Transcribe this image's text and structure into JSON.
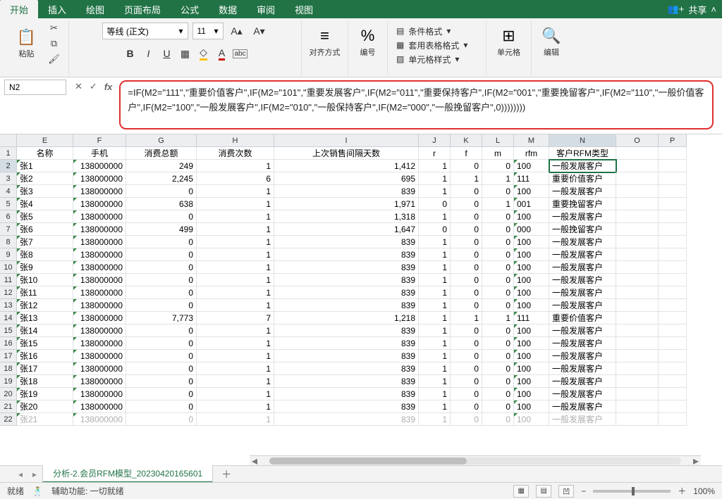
{
  "tabs": {
    "items": [
      "开始",
      "插入",
      "绘图",
      "页面布局",
      "公式",
      "数据",
      "审阅",
      "视图"
    ],
    "active_index": 0,
    "share": "共享"
  },
  "ribbon": {
    "clipboard": {
      "paste": "粘贴",
      "group": ""
    },
    "font": {
      "name": "等线 (正文)",
      "size": "11",
      "buttons": {
        "bold": "B",
        "italic": "I",
        "underline": "U"
      }
    },
    "alignment": {
      "label": "对齐方式",
      "wrap": "ab"
    },
    "number": {
      "label": "编号",
      "percent": "%"
    },
    "style": {
      "cond": "条件格式",
      "table": "套用表格格式",
      "cell": "单元格样式"
    },
    "cells": {
      "label": "单元格"
    },
    "editing": {
      "label": "编辑"
    }
  },
  "formula_bar": {
    "cell_ref": "N2",
    "formula": "=IF(M2=\"111\",\"重要价值客户\",IF(M2=\"101\",\"重要发展客户\",IF(M2=\"011\",\"重要保持客户\",IF(M2=\"001\",\"重要挽留客户\",IF(M2=\"110\",\"一般价值客户\",IF(M2=\"100\",\"一般发展客户\",IF(M2=\"010\",\"一般保持客户\",IF(M2=\"000\",\"一般挽留客户\",0))))))))"
  },
  "columns": [
    "E",
    "F",
    "G",
    "H",
    "I",
    "J",
    "K",
    "L",
    "M",
    "N",
    "O",
    "P"
  ],
  "headers": {
    "E": "名称",
    "F": "手机",
    "G": "消费总额",
    "H": "消费次数",
    "I": "上次销售间隔天数",
    "J": "r",
    "K": "f",
    "L": "m",
    "M": "rfm",
    "N": "客户RFM类型"
  },
  "rows": [
    {
      "n": 2,
      "E": "张1",
      "F": "138000000",
      "G": "249",
      "H": "1",
      "I": "1,412",
      "J": "1",
      "K": "0",
      "L": "0",
      "M": "100",
      "N": "一般发展客户"
    },
    {
      "n": 3,
      "E": "张2",
      "F": "138000000",
      "G": "2,245",
      "H": "6",
      "I": "695",
      "J": "1",
      "K": "1",
      "L": "1",
      "M": "111",
      "N": "重要价值客户"
    },
    {
      "n": 4,
      "E": "张3",
      "F": "138000000",
      "G": "0",
      "H": "1",
      "I": "839",
      "J": "1",
      "K": "0",
      "L": "0",
      "M": "100",
      "N": "一般发展客户"
    },
    {
      "n": 5,
      "E": "张4",
      "F": "138000000",
      "G": "638",
      "H": "1",
      "I": "1,971",
      "J": "0",
      "K": "0",
      "L": "1",
      "M": "001",
      "N": "重要挽留客户"
    },
    {
      "n": 6,
      "E": "张5",
      "F": "138000000",
      "G": "0",
      "H": "1",
      "I": "1,318",
      "J": "1",
      "K": "0",
      "L": "0",
      "M": "100",
      "N": "一般发展客户"
    },
    {
      "n": 7,
      "E": "张6",
      "F": "138000000",
      "G": "499",
      "H": "1",
      "I": "1,647",
      "J": "0",
      "K": "0",
      "L": "0",
      "M": "000",
      "N": "一般挽留客户"
    },
    {
      "n": 8,
      "E": "张7",
      "F": "138000000",
      "G": "0",
      "H": "1",
      "I": "839",
      "J": "1",
      "K": "0",
      "L": "0",
      "M": "100",
      "N": "一般发展客户"
    },
    {
      "n": 9,
      "E": "张8",
      "F": "138000000",
      "G": "0",
      "H": "1",
      "I": "839",
      "J": "1",
      "K": "0",
      "L": "0",
      "M": "100",
      "N": "一般发展客户"
    },
    {
      "n": 10,
      "E": "张9",
      "F": "138000000",
      "G": "0",
      "H": "1",
      "I": "839",
      "J": "1",
      "K": "0",
      "L": "0",
      "M": "100",
      "N": "一般发展客户"
    },
    {
      "n": 11,
      "E": "张10",
      "F": "138000000",
      "G": "0",
      "H": "1",
      "I": "839",
      "J": "1",
      "K": "0",
      "L": "0",
      "M": "100",
      "N": "一般发展客户"
    },
    {
      "n": 12,
      "E": "张11",
      "F": "138000000",
      "G": "0",
      "H": "1",
      "I": "839",
      "J": "1",
      "K": "0",
      "L": "0",
      "M": "100",
      "N": "一般发展客户"
    },
    {
      "n": 13,
      "E": "张12",
      "F": "138000000",
      "G": "0",
      "H": "1",
      "I": "839",
      "J": "1",
      "K": "0",
      "L": "0",
      "M": "100",
      "N": "一般发展客户"
    },
    {
      "n": 14,
      "E": "张13",
      "F": "138000000",
      "G": "7,773",
      "H": "7",
      "I": "1,218",
      "J": "1",
      "K": "1",
      "L": "1",
      "M": "111",
      "N": "重要价值客户"
    },
    {
      "n": 15,
      "E": "张14",
      "F": "138000000",
      "G": "0",
      "H": "1",
      "I": "839",
      "J": "1",
      "K": "0",
      "L": "0",
      "M": "100",
      "N": "一般发展客户"
    },
    {
      "n": 16,
      "E": "张15",
      "F": "138000000",
      "G": "0",
      "H": "1",
      "I": "839",
      "J": "1",
      "K": "0",
      "L": "0",
      "M": "100",
      "N": "一般发展客户"
    },
    {
      "n": 17,
      "E": "张16",
      "F": "138000000",
      "G": "0",
      "H": "1",
      "I": "839",
      "J": "1",
      "K": "0",
      "L": "0",
      "M": "100",
      "N": "一般发展客户"
    },
    {
      "n": 18,
      "E": "张17",
      "F": "138000000",
      "G": "0",
      "H": "1",
      "I": "839",
      "J": "1",
      "K": "0",
      "L": "0",
      "M": "100",
      "N": "一般发展客户"
    },
    {
      "n": 19,
      "E": "张18",
      "F": "138000000",
      "G": "0",
      "H": "1",
      "I": "839",
      "J": "1",
      "K": "0",
      "L": "0",
      "M": "100",
      "N": "一般发展客户"
    },
    {
      "n": 20,
      "E": "张19",
      "F": "138000000",
      "G": "0",
      "H": "1",
      "I": "839",
      "J": "1",
      "K": "0",
      "L": "0",
      "M": "100",
      "N": "一般发展客户"
    },
    {
      "n": 21,
      "E": "张20",
      "F": "138000000",
      "G": "0",
      "H": "1",
      "I": "839",
      "J": "1",
      "K": "0",
      "L": "0",
      "M": "100",
      "N": "一般发展客户"
    },
    {
      "n": 22,
      "E": "张21",
      "F": "138000000",
      "G": "0",
      "H": "1",
      "I": "839",
      "J": "1",
      "K": "0",
      "L": "0",
      "M": "100",
      "N": "一般发展客户"
    }
  ],
  "sheet": {
    "name": "分析-2.会员RFM模型_20230420165601"
  },
  "status": {
    "ready": "就绪",
    "a11y": "辅助功能: 一切就绪",
    "zoom": "100%"
  }
}
